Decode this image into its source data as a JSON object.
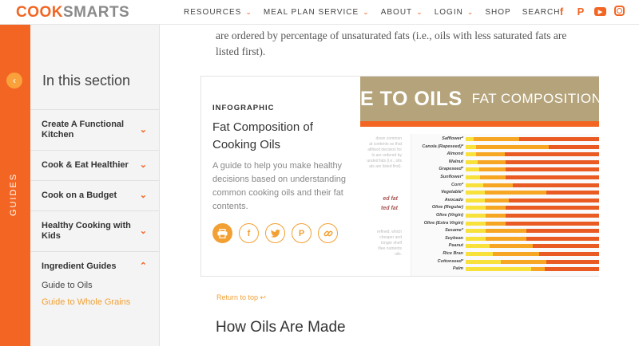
{
  "header": {
    "logo_part1": "COOK",
    "logo_part2": "SMARTS",
    "nav": [
      {
        "label": "RESOURCES",
        "has_dropdown": true
      },
      {
        "label": "MEAL PLAN SERVICE",
        "has_dropdown": true
      },
      {
        "label": "ABOUT",
        "has_dropdown": true
      },
      {
        "label": "LOGIN",
        "has_dropdown": true
      },
      {
        "label": "SHOP",
        "has_dropdown": false
      },
      {
        "label": "SEARCH",
        "has_dropdown": false
      }
    ],
    "social": {
      "facebook": "f",
      "pinterest": "P",
      "youtube": "▶",
      "instagram": ""
    }
  },
  "guides_label": "GUIDES",
  "sidebar": {
    "section_title": "In this section",
    "items": [
      {
        "label": "Create A Functional Kitchen",
        "expanded": false
      },
      {
        "label": "Cook & Eat Healthier",
        "expanded": false
      },
      {
        "label": "Cook on a Budget",
        "expanded": false
      },
      {
        "label": "Healthy Cooking with Kids",
        "expanded": false
      },
      {
        "label": "Ingredient Guides",
        "expanded": true
      }
    ],
    "sub_items": [
      {
        "label": "Guide to Oils",
        "active": false
      },
      {
        "label": "Guide to Whole Grains",
        "active": true
      }
    ]
  },
  "main": {
    "intro_text": "are ordered by percentage of unsaturated fats (i.e., oils with less saturated fats are listed first).",
    "card": {
      "eyebrow": "INFOGRAPHIC",
      "title": "Fat Composition of Cooking Oils",
      "description": "A guide to help you make healthy decisions based on understanding common cooking oils and their fat contents.",
      "share_icons": [
        "print-icon",
        "facebook-icon",
        "twitter-icon",
        "pinterest-icon",
        "link-icon"
      ],
      "infographic": {
        "banner_left": "E TO OILS",
        "banner_right": "FAT COMPOSITION OF COO",
        "faded_heading_1": "ed fat",
        "faded_heading_2": "ted fat",
        "oils": [
          "Safflower*",
          "Canola (Rapeseed)*",
          "Almond",
          "Walnut",
          "Grapeseed*",
          "Sunflower*",
          "Corn*",
          "Vegetable*",
          "Avocado",
          "Olive (Regular)",
          "Olive (Virgin)",
          "Olive (Extra Virgin)",
          "Sesame*",
          "Soybean",
          "Peanut",
          "Rice Bran",
          "Cottonseed*",
          "Palm"
        ]
      }
    },
    "return_to_top": "Return to top ↩",
    "section_heading": "How Oils Are Made"
  },
  "colors": {
    "accent": "#f26522",
    "gold": "#f2a033",
    "banner": "#b5a47b"
  }
}
